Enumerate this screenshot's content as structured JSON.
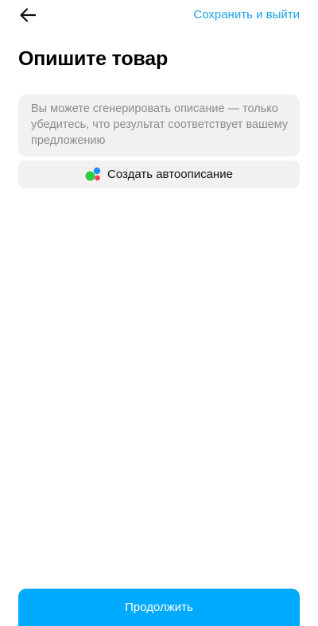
{
  "header": {
    "back_icon": "arrow-left-icon",
    "save_exit_label": "Сохранить и выйти"
  },
  "page": {
    "title": "Опишите товар"
  },
  "description": {
    "placeholder": "Вы можете сгенерировать описание — только убедитесь, что результат соответствует вашему предложению",
    "value": ""
  },
  "auto_description": {
    "label": "Создать автоописание",
    "icon": "colored-dots-icon",
    "icon_colors": [
      "#2ecc40",
      "#1e90ff",
      "#ff3b5c"
    ]
  },
  "footer": {
    "continue_label": "Продолжить"
  },
  "colors": {
    "accent": "#00aaff",
    "link": "#1aa3e8",
    "field_background": "#f2f1f0",
    "placeholder_text": "#8b8b8b"
  }
}
